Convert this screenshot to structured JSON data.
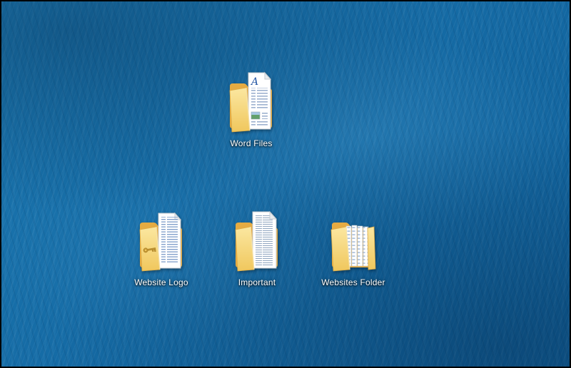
{
  "wallpaper": {
    "name": "blue-ocean-water",
    "base_color": "#1571a8"
  },
  "desktop": {
    "icons": [
      {
        "label": "Word Files",
        "icon": "folder-with-word-document-icon",
        "doc_letter": "A"
      },
      {
        "label": "Website Logo",
        "icon": "folder-with-logo-document-icon"
      },
      {
        "label": "Important",
        "icon": "folder-with-text-document-icon"
      },
      {
        "label": "Websites Folder",
        "icon": "folder-with-files-icon"
      }
    ]
  },
  "colors": {
    "folder_front": "#f5d57b",
    "folder_back": "#e5ab42",
    "document_white": "#ffffff",
    "document_line_blue": "#8aa7cc",
    "word_letter_blue": "#2456a4",
    "label_text": "#ffffff",
    "frame_border": "#000000"
  }
}
